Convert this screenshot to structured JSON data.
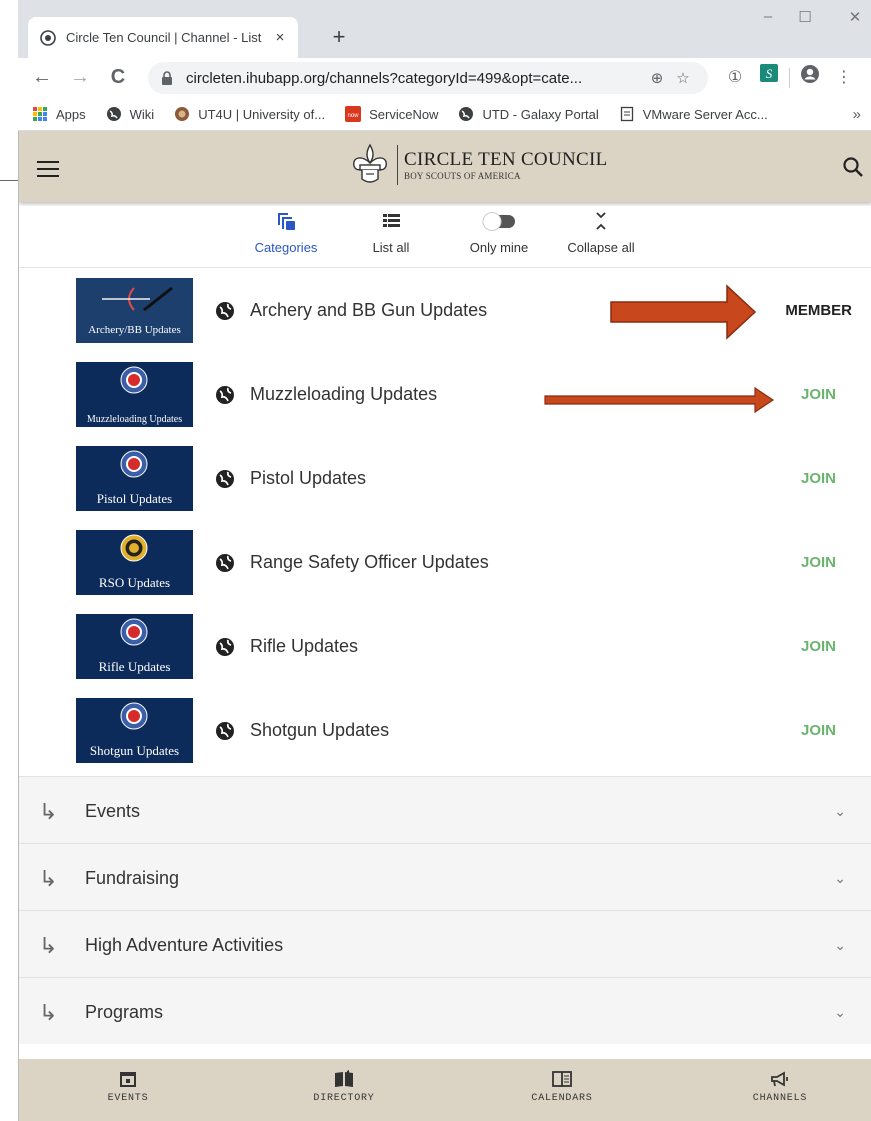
{
  "browser": {
    "tab_title": "Circle Ten Council | Channel - List",
    "tab_close": "×",
    "new_tab": "+",
    "url": "circleten.ihubapp.org/channels?categoryId=499&opt=cate...",
    "window_controls": {
      "minimize": "–",
      "maximize": "☐",
      "close": "✕"
    },
    "nav": {
      "back": "←",
      "forward": "→",
      "reload": "C"
    },
    "bookmarks": [
      {
        "label": "Apps",
        "icon": "apps-grid-icon"
      },
      {
        "label": "Wiki",
        "icon": "globe-icon"
      },
      {
        "label": "UT4U | University of...",
        "icon": "ut-logo-icon"
      },
      {
        "label": "ServiceNow",
        "icon": "servicenow-icon"
      },
      {
        "label": "UTD - Galaxy Portal",
        "icon": "globe-icon"
      },
      {
        "label": "VMware Server Acc...",
        "icon": "document-icon"
      }
    ],
    "bookmarks_more": "»"
  },
  "app": {
    "logo_line1": "CIRCLE TEN COUNCIL",
    "logo_line2": "BOY SCOUTS OF AMERICA",
    "filters": {
      "categories": "Categories",
      "list_all": "List all",
      "only_mine": "Only mine",
      "collapse_all": "Collapse all"
    },
    "channels": [
      {
        "thumb": "Archery/BB Updates",
        "title": "Archery and BB Gun Updates",
        "action": "MEMBER"
      },
      {
        "thumb": "Muzzleloading Updates",
        "title": "Muzzleloading Updates",
        "action": "JOIN"
      },
      {
        "thumb": "Pistol Updates",
        "title": "Pistol Updates",
        "action": "JOIN"
      },
      {
        "thumb": "RSO Updates",
        "title": "Range Safety Officer Updates",
        "action": "JOIN"
      },
      {
        "thumb": "Rifle Updates",
        "title": "Rifle Updates",
        "action": "JOIN"
      },
      {
        "thumb": "Shotgun Updates",
        "title": "Shotgun Updates",
        "action": "JOIN"
      }
    ],
    "groups": [
      {
        "title": "Events"
      },
      {
        "title": "Fundraising"
      },
      {
        "title": "High Adventure Activities"
      },
      {
        "title": "Programs"
      }
    ],
    "bottom_nav": {
      "events": "EVENTS",
      "directory": "DIRECTORY",
      "calendars": "CALENDARS",
      "channels": "CHANNELS"
    },
    "colors": {
      "appbar": "#dbd4c5",
      "join": "#6ab56e",
      "active_filter": "#2a56c6",
      "thumb_bg": "#0c2a5a",
      "arrow": "#c8471c"
    }
  }
}
